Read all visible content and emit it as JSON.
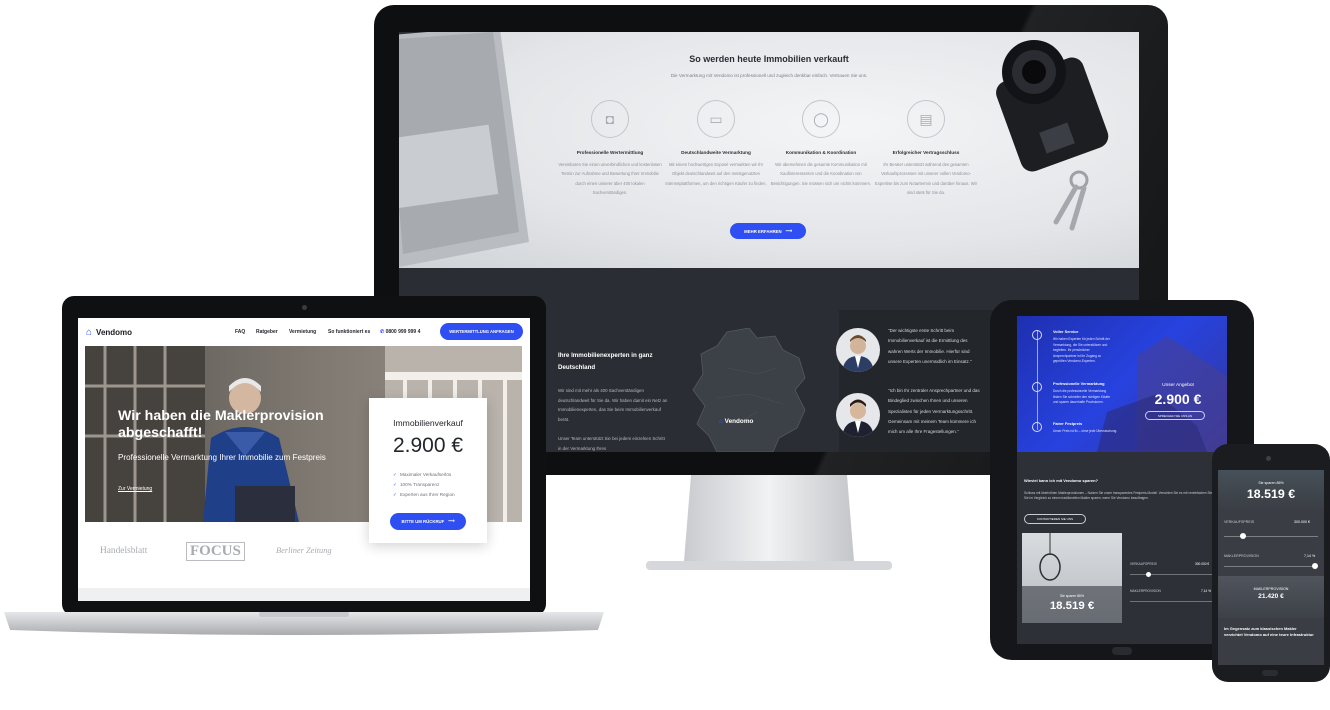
{
  "imac": {
    "section_title": "So werden heute Immobilien verkauft",
    "section_subtitle": "Die Vermarktung mit Vendomo ist professionell und zugleich denkbar einfach. Vertrauen Sie uns.",
    "features": [
      {
        "icon": "camera-icon",
        "title": "Professionelle Wertermittlung",
        "text": "Vereinbaren Sie einen unverbindlichen und kostenlosen Termin zur Aufnahme und Bewertung Ihrer Immobilie durch einen unserer über 400 lokalen Sachverständigen."
      },
      {
        "icon": "laptop-icon",
        "title": "Deutschlandweite Vermarktung",
        "text": "Mit einem hochwertigen Exposé vermarkten wir Ihr Objekt deutschlandweit auf den meistgenutzten Internetplattformen, um den richtigen Käufer zu finden."
      },
      {
        "icon": "chat-icon",
        "title": "Kommunikation & Koordination",
        "text": "Wir übernehmen die gesamte Kommunikation mit Kaufinteressenten und die Koordination von Besichtigungen. Sie müssen sich um nichts kümmern."
      },
      {
        "icon": "document-icon",
        "title": "Erfolgreicher Vertragsschluss",
        "text": "Ihr Berater unterstützt während des gesamten Verkaufsprozesses mit unserer vollen Vendomo-Expertise bis zum Notartermin und darüber hinaus. Wir sind stets für Sie da."
      }
    ],
    "more_button": "MEHR ERFAHREN",
    "experts_title": "Ihre Immobilienexperten in ganz Deutschland",
    "experts_text1": "Wir sind mit mehr als 400 Sachverständigen deutschlandweit für Sie da. Wir haben damit ein Netz an Immobilienexperten, das Sie beim Immobilienverkauf berät.",
    "experts_text2": "Unser Team unterstützt Sie bei jedem einzelnen Schritt in der Vermarktung Ihres",
    "map_logo": "Vendomo",
    "quote1": "\"Der wichtigste erste Schritt beim Immobilienverkauf ist die Ermittlung des wahren Werts der Immobilie. Hierfür sind unsere Experten unermüdlich im Einsatz.\"",
    "quote2": "\"Ich bin Ihr zentraler Ansprechpartner und das Bindeglied zwischen Ihnen und unseren Spezialisten für jeden Vermarktungsschritt. Gemeinsam mit meinem Team kümmere ich mich um alle Ihre Fragestellungen.\""
  },
  "laptop": {
    "logo": "Vendomo",
    "nav": [
      "FAQ",
      "Ratgeber",
      "Vermietung",
      "So funktioniert es"
    ],
    "phone": "0800 999 999 4",
    "cta": "WERTERMITTLUNG ANFRAGEN",
    "hero_title": "Wir haben die Maklerprovision abgeschafft!",
    "hero_subtitle": "Professionelle Vermarktung Ihrer Immobilie zum Festpreis",
    "hero_link": "Zur Vermietung",
    "price_title": "Immobilienverkauf",
    "price": "2.900 €",
    "checklist": [
      "Maximaler Verkaufserlös",
      "100% Transparenz",
      "Experten aus Ihrer Region"
    ],
    "callback_button": "BITTE UM RÜCKRUF",
    "press": [
      "Handelsblatt",
      "FOCUS",
      "Berliner Zeitung"
    ]
  },
  "tablet": {
    "timeline": [
      {
        "title": "Voller Service",
        "text": "Wir haben Experten für jeden Schritt der Vermarktung, die Sie unterstützen und begleiten. Ihr persönlicher Ansprechpartner ist Ihr Zugang zu geprüften Vendomo-Experten."
      },
      {
        "title": "Professionelle Vermarktung",
        "text": "Durch die professionelle Vermarktung finden Sie schneller den richtigen Käufer und sparen dauerhafte Provisionen."
      },
      {
        "title": "Fairer Festpreis",
        "text": "Unser Preis ist fix – ohne jede Überraschung."
      }
    ],
    "offer_title": "Unser Angebot",
    "offer_price": "2.900 €",
    "offer_button": "SPRECHEN SIE UNS AN",
    "why_title": "Wieviel kann ich mit Vendomo sparen?",
    "why_text": "Schluss mit überhöhten Maklerprovisionen – Nutzen Sie unser transparentes Festpreis-Modell. Verschlen Sie es mit vereinfachen Sie, wieviel Sie im Vergleich zu einem traditionellen Makler sparen, wenn Sie Vendomo beauftragen.",
    "contact_button": "KONTAKTIEREN SIE UNS",
    "save_label": "Sie sparen 86%",
    "save_value": "18.519 €",
    "rows": [
      {
        "label": "VERKAUFSPREIS",
        "value": "300.000 €",
        "fill": 0.2
      },
      {
        "label": "MAKLERPROVISION",
        "value": "7,14 %",
        "fill": 0.95
      }
    ]
  },
  "phone": {
    "save_label": "Sie sparen 86%",
    "save_value": "18.519 €",
    "rows": [
      {
        "label": "VERKAUFSPREIS",
        "value": "300.000 €",
        "fill": 0.2
      },
      {
        "label": "MAKLERPROVISION",
        "value": "7,14 %",
        "fill": 0.95
      }
    ],
    "commission_label": "MAKLERPROVISION",
    "commission_value": "21.420 €",
    "bottom_text": "Im Gegensatz zum klassischen Makler verzichtet Vendomo auf eine teure Infrastruktur"
  },
  "colors": {
    "accent": "#2f4ff2",
    "dark": "#2a2d33"
  }
}
